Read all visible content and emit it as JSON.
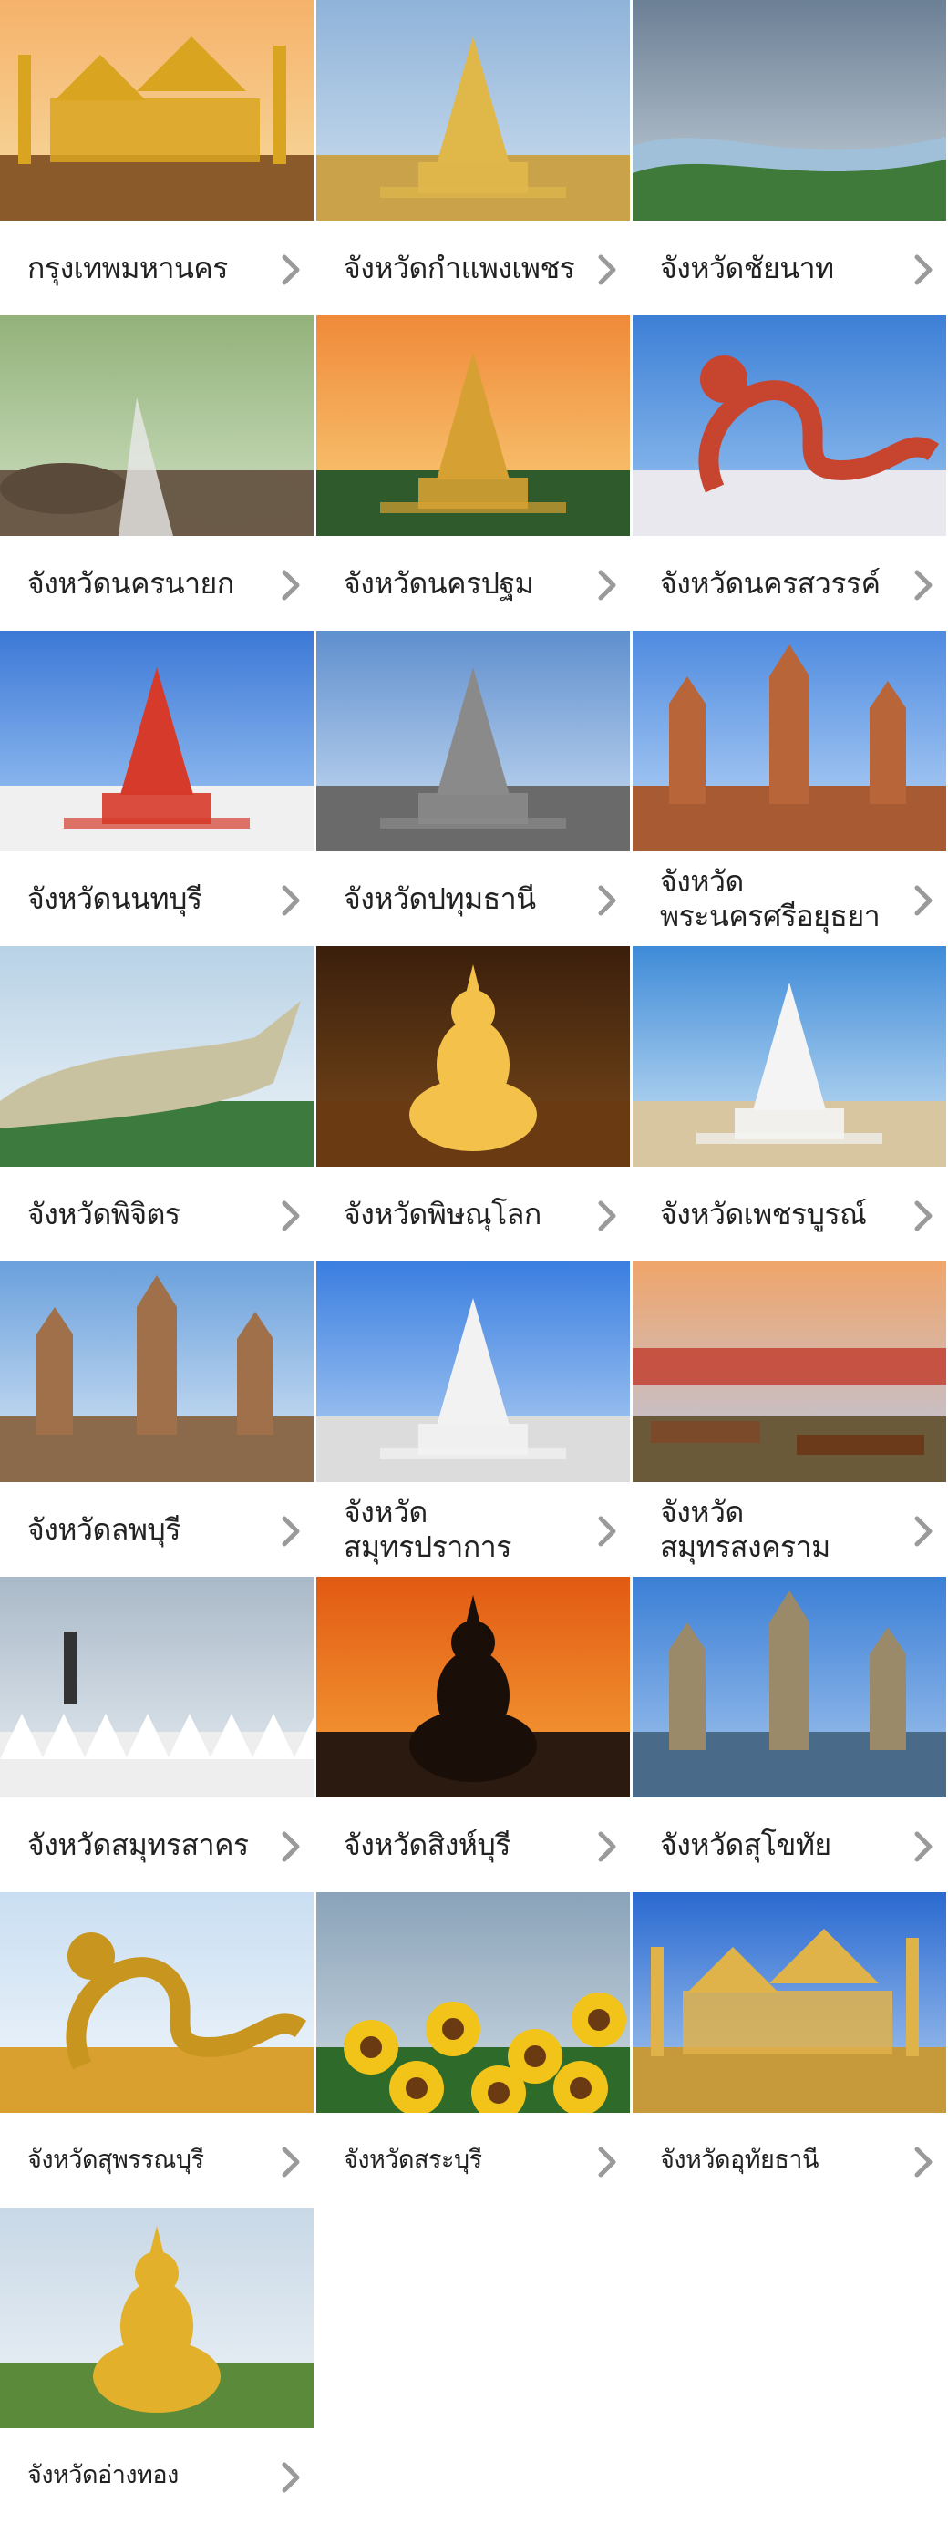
{
  "provinces": [
    {
      "name": "กรุงเทพมหานคร",
      "scene": "grand-palace-photo"
    },
    {
      "name": "จังหวัดกำแพงเพชร",
      "scene": "golden-pagoda-photo"
    },
    {
      "name": "จังหวัดชัยนาท",
      "scene": "river-valley-photo"
    },
    {
      "name": "จังหวัดนครนายก",
      "scene": "mountain-stream-photo"
    },
    {
      "name": "จังหวัดนครปฐม",
      "scene": "sunset-pagoda-photo"
    },
    {
      "name": "จังหวัดนครสวรรค์",
      "scene": "dragon-statue-photo"
    },
    {
      "name": "จังหวัดนนทบุรี",
      "scene": "white-pagoda-flags-photo"
    },
    {
      "name": "จังหวัดปทุมธานี",
      "scene": "stone-temple-tower-photo"
    },
    {
      "name": "จังหวัดพระนครศรีอยุธยา",
      "scene": "ayutthaya-ruins-photo"
    },
    {
      "name": "จังหวัดพิจิตร",
      "scene": "crocodile-statue-photo"
    },
    {
      "name": "จังหวัดพิษณุโลก",
      "scene": "golden-buddha-photo"
    },
    {
      "name": "จังหวัดเพชรบูรณ์",
      "scene": "white-buddha-hill-photo"
    },
    {
      "name": "จังหวัดลพบุรี",
      "scene": "khmer-ruins-monkey-photo"
    },
    {
      "name": "จังหวัดสมุทรปราการ",
      "scene": "white-stupa-photo"
    },
    {
      "name": "จังหวัดสมุทรสงคราม",
      "scene": "floating-market-photo"
    },
    {
      "name": "จังหวัดสมุทรสาคร",
      "scene": "salt-farm-photo"
    },
    {
      "name": "จังหวัดสิงห์บุรี",
      "scene": "buddha-silhouette-sunset-photo"
    },
    {
      "name": "จังหวัดสุโขทัย",
      "scene": "sukhothai-historical-park-photo"
    },
    {
      "name": "จังหวัดสุพรรณบุรี",
      "scene": "golden-dragon-fountain-photo"
    },
    {
      "name": "จังหวัดสระบุรี",
      "scene": "sunflower-field-photo"
    },
    {
      "name": "จังหวัดอุทัยธานี",
      "scene": "golden-temple-photo"
    },
    {
      "name": "จังหวัดอ่างทอง",
      "scene": "giant-buddha-photo"
    }
  ],
  "colors": {
    "label": "#222222",
    "chevron": "#9a9a9a",
    "background": "#ffffff"
  },
  "icons": {
    "chevron": "chevron-right-icon"
  }
}
